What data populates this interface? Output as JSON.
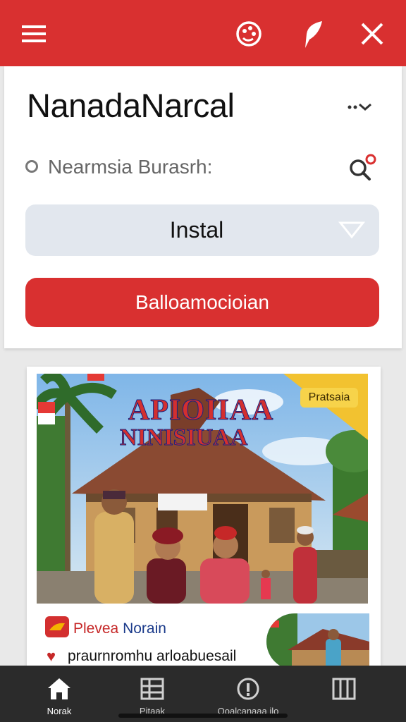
{
  "topbar": {
    "menu_icon": "hamburger-menu-icon",
    "palette_icon": "palette-icon",
    "leaf_icon": "leaf-icon",
    "close_icon": "close-icon",
    "color": "#d93030"
  },
  "header": {
    "title": "NanadaNarcal",
    "more_icon": "more-chevron-icon"
  },
  "search": {
    "text": "Nearmsia Burasrh:",
    "icon": "search-icon"
  },
  "select": {
    "value": "Instal"
  },
  "primary_button": {
    "label": "Balloamocioian"
  },
  "banner": {
    "title_line1": "APIOIIAA",
    "title_line2": "NINISIUAA",
    "badge": "Pratsaia"
  },
  "promo": {
    "title_part1": "Plevea",
    "title_part2": "Norain",
    "subtitle": "praurnromhu arloabuesail"
  },
  "nav": {
    "items": [
      {
        "label": "Norak",
        "icon": "home-icon"
      },
      {
        "label": "Pitaak",
        "icon": "grid-icon"
      },
      {
        "label": "Qoalcanaaa ilo",
        "icon": "info-circle-icon"
      },
      {
        "label": "",
        "icon": "columns-icon"
      }
    ]
  },
  "colors": {
    "accent": "#d93030",
    "select_bg": "#e2e7ee",
    "nav_bg": "#2b2b2b"
  }
}
